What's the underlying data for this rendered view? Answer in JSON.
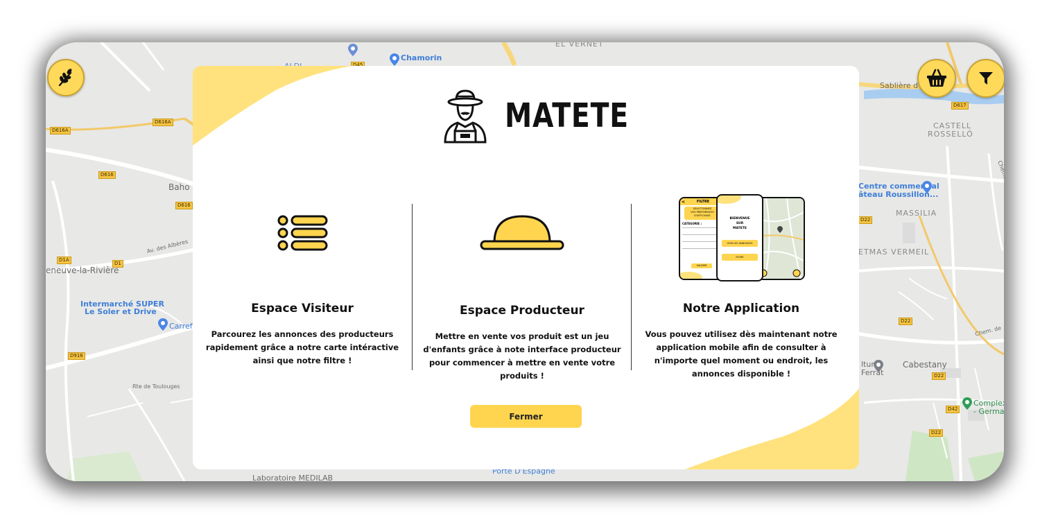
{
  "app": {
    "name": "MATETE"
  },
  "colors": {
    "accent": "#ffd54f",
    "modal_bg": "#ffffff",
    "text": "#111111"
  },
  "map": {
    "labels": {
      "chamorin": "Chamorin",
      "aldi": "ALDI",
      "el_vernet": "EL VERNET",
      "sabliere": "Sablière d",
      "castell_1": "CASTELL",
      "castell_2": "ROSSELLÓ",
      "baho": "Baho",
      "centre_1": "Centre commercial",
      "centre_2": "âteau Roussillon...",
      "massilia": "MASSILIA",
      "mas_vermeil": "ETMAS VERMEIL",
      "neuve": "eneuve-la-Rivière",
      "albere": "Av. des Albères",
      "intermarche_1": "Intermarché SUPER",
      "intermarche_2": "Le Soler et Drive",
      "carrefour": "Carrefo",
      "toulouges": "Rte de Toulouges",
      "cabestany": "Cabestany",
      "culturel_1": "lturel",
      "culturel_2": "Ferrat",
      "complexe_1": "Complexe",
      "complexe_2": "- Germanc",
      "porte_espagne": "Porte D'Espagne",
      "medilab": "Laboratoire MEDILAB",
      "chem": "Chem. de",
      "chem_charles": "Chem. de Charles"
    },
    "road_tags": {
      "d616a_1": "D616A",
      "d616a_2": "D616A",
      "d616_1": "D616",
      "d616_2": "D616",
      "d1a": "D1A",
      "d1": "D1",
      "d916": "D916",
      "d617": "D617",
      "d22_1": "D22",
      "d22_2": "D22",
      "d22_3": "D22",
      "d22_4": "D22",
      "d42": "D42",
      "d45": "D45"
    }
  },
  "controls": {
    "logo_icon": "wheat-icon",
    "basket_icon": "basket-icon",
    "filter_icon": "filter-icon"
  },
  "modal": {
    "sections": [
      {
        "title": "Espace Visiteur",
        "text": "Parcourez les annonces des producteurs rapidement grâce a notre carte intéractive ainsi que notre filtre !",
        "icon": "list-icon"
      },
      {
        "title": "Espace Producteur",
        "text": "Mettre en vente vos produit est un jeu d'enfants grâce à note interface producteur pour commencer à mettre en vente votre produits !",
        "icon": "hat-icon"
      },
      {
        "title": "Notre Application",
        "text": "Vous pouvez utilisez dès maintenant notre application mobile afin de consulter à n'importe quel moment ou endroit, les annonces disponible !",
        "icon": "phones-mockup"
      }
    ],
    "close_label": "Fermer",
    "phone_mockup": {
      "filtre": "FILTRE",
      "selection_1": "SELECTIONNEZ",
      "selection_2": "VOS PREFERENCES",
      "selection_3": "D'AFFICHAGE",
      "categorie": "CATEGORIE :",
      "valider": "VALIDER",
      "bienvenue_1": "BIENVENUE",
      "bienvenue_2": "SUR",
      "bienvenue_3": "MATETE",
      "voir_annonces": "VOIR LES ANNONCES",
      "filtre_btn": "FILTRE"
    }
  }
}
